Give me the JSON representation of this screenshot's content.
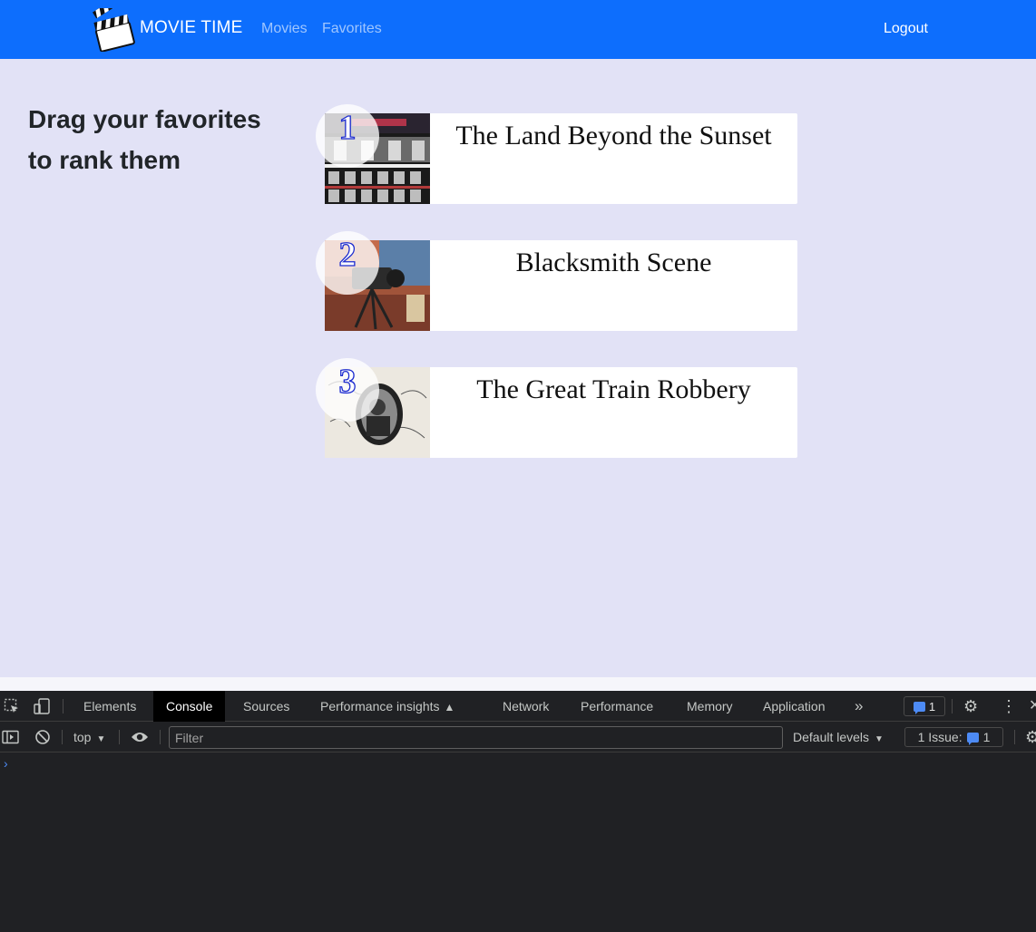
{
  "navbar": {
    "brand": "MOVIE TIME",
    "links": [
      "Movies",
      "Favorites"
    ],
    "logout": "Logout"
  },
  "main": {
    "heading": "Drag your favorites to rank them",
    "favorites": [
      {
        "rank": "1",
        "title": "The Land Beyond the Sunset"
      },
      {
        "rank": "2",
        "title": "Blacksmith Scene"
      },
      {
        "rank": "3",
        "title": "The Great Train Robbery"
      }
    ]
  },
  "devtools": {
    "tabs": [
      "Elements",
      "Console",
      "Sources",
      "Performance insights",
      "Network",
      "Performance",
      "Memory",
      "Application"
    ],
    "active_tab": "Console",
    "badge_count": "1",
    "context": "top",
    "filter_placeholder": "Filter",
    "levels": "Default levels",
    "issues_label": "1 Issue:",
    "issues_count": "1",
    "prompt": "›"
  },
  "colors": {
    "navbar": "#0d6efd",
    "page_bg": "#e2e2f6",
    "rank_stroke": "#1c2bcf",
    "devtools_bg": "#202124"
  },
  "icons": [
    "clapperboard-icon",
    "inspect-icon",
    "device-toggle-icon",
    "more-tabs-icon",
    "issues-chat-icon",
    "settings-icon",
    "kebab-menu-icon",
    "close-icon",
    "sidebar-toggle-icon",
    "clear-console-icon",
    "eye-icon",
    "dropdown-arrow-icon",
    "settings-icon"
  ]
}
